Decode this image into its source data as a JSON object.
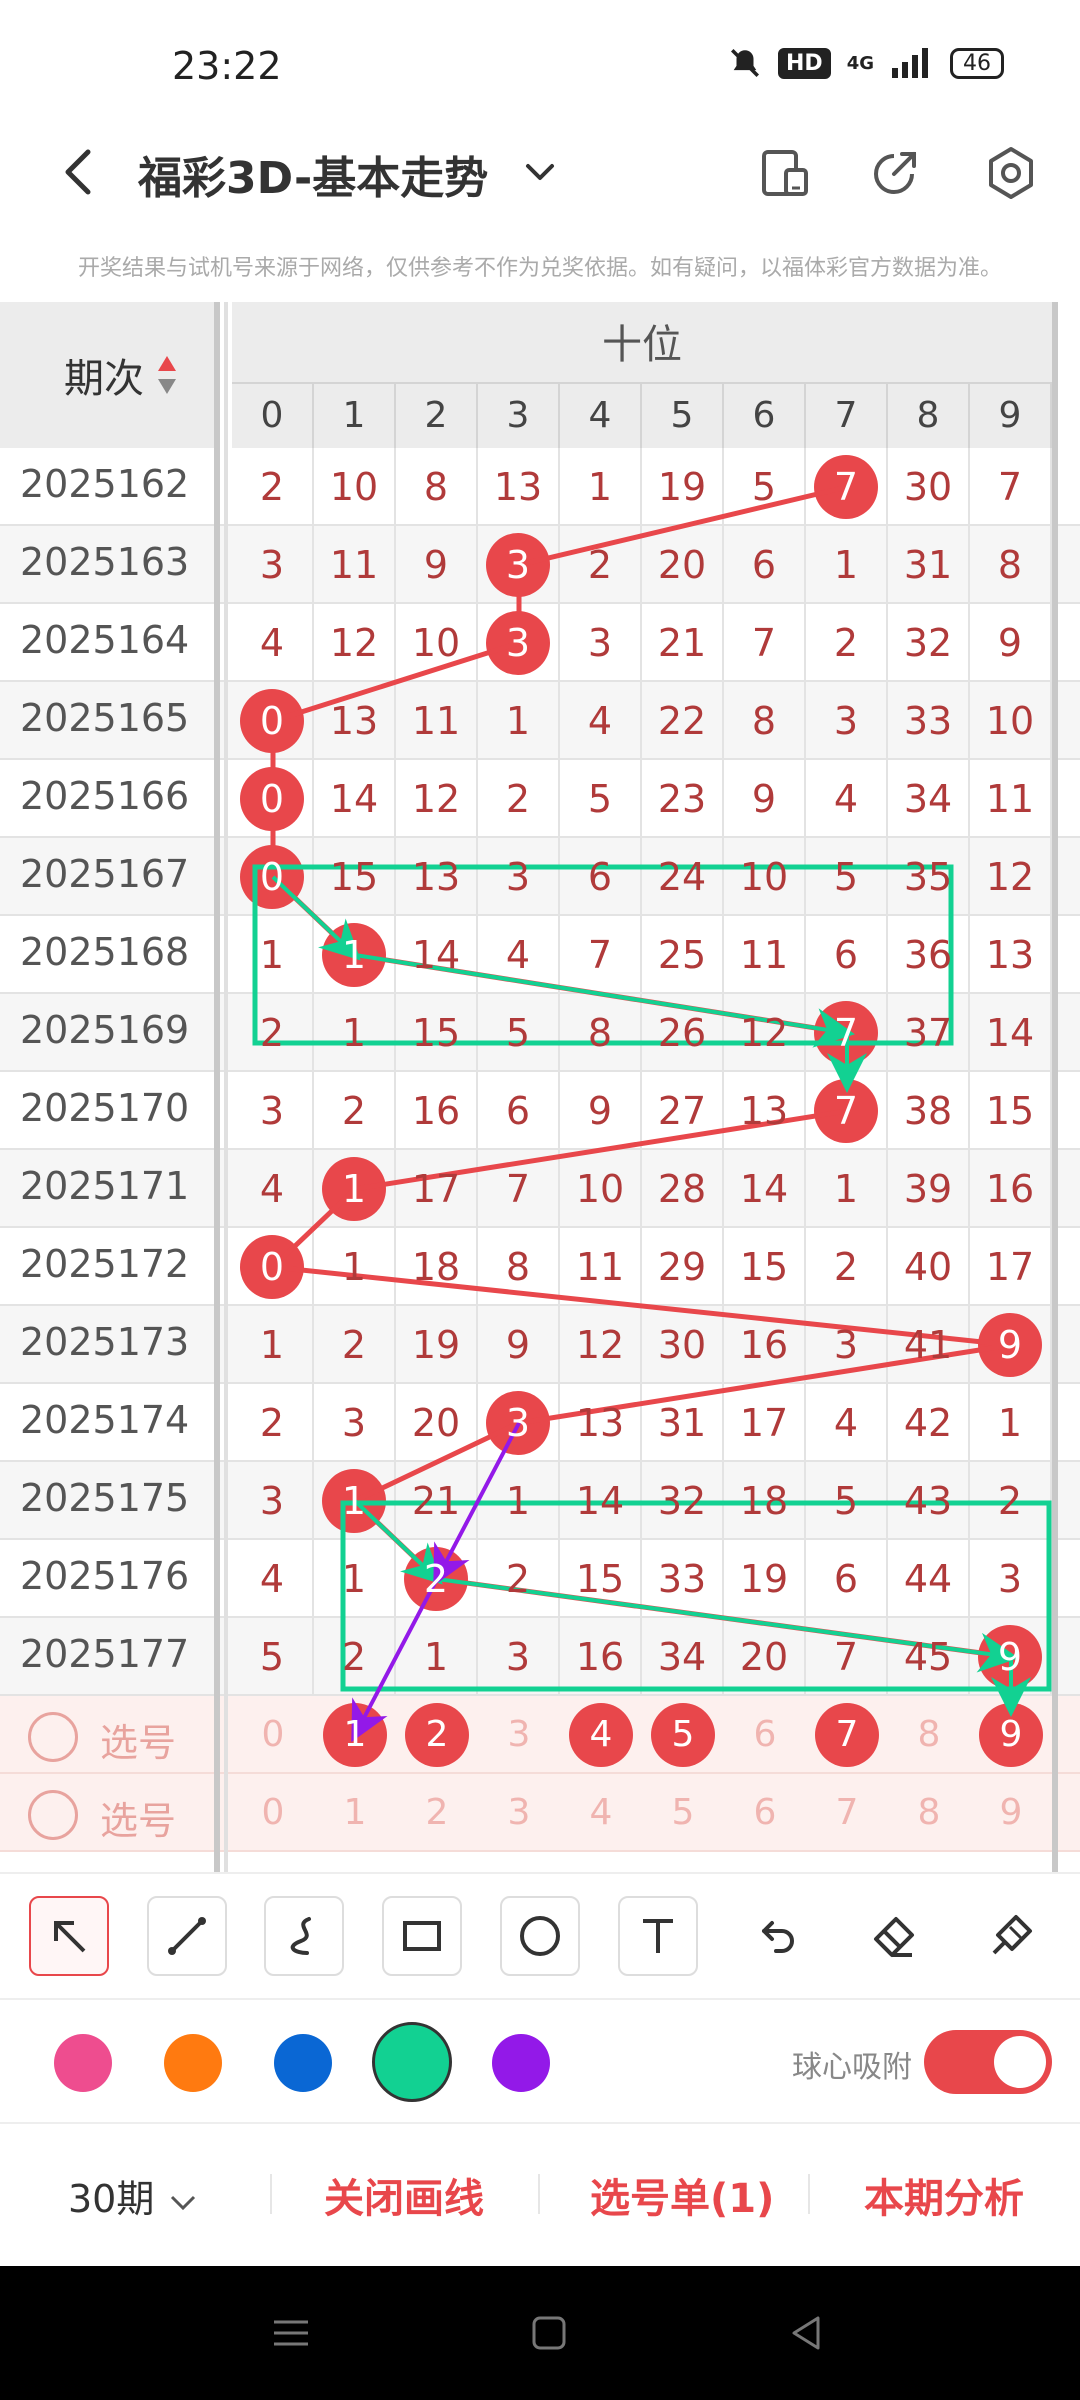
{
  "status": {
    "time": "23:22",
    "network": "4G",
    "battery": "46"
  },
  "header": {
    "title": "福彩3D-基本走势"
  },
  "notice": "开奖结果与试机号来源于网络，仅供参考不作为兑奖依据。如有疑问，以福体彩官方数据为准。",
  "table": {
    "period_header": "期次",
    "group_header": "十位",
    "digits": [
      "0",
      "1",
      "2",
      "3",
      "4",
      "5",
      "6",
      "7",
      "8",
      "9"
    ],
    "rows": [
      {
        "period": "2025162",
        "cells": [
          "2",
          "10",
          "8",
          "13",
          "1",
          "19",
          "5",
          "7",
          "30",
          "7"
        ],
        "hit": 7
      },
      {
        "period": "2025163",
        "cells": [
          "3",
          "11",
          "9",
          "3",
          "2",
          "20",
          "6",
          "1",
          "31",
          "8"
        ],
        "hit": 3
      },
      {
        "period": "2025164",
        "cells": [
          "4",
          "12",
          "10",
          "3",
          "3",
          "21",
          "7",
          "2",
          "32",
          "9"
        ],
        "hit": 3
      },
      {
        "period": "2025165",
        "cells": [
          "0",
          "13",
          "11",
          "1",
          "4",
          "22",
          "8",
          "3",
          "33",
          "10"
        ],
        "hit": 0
      },
      {
        "period": "2025166",
        "cells": [
          "0",
          "14",
          "12",
          "2",
          "5",
          "23",
          "9",
          "4",
          "34",
          "11"
        ],
        "hit": 0
      },
      {
        "period": "2025167",
        "cells": [
          "0",
          "15",
          "13",
          "3",
          "6",
          "24",
          "10",
          "5",
          "35",
          "12"
        ],
        "hit": 0
      },
      {
        "period": "2025168",
        "cells": [
          "1",
          "1",
          "14",
          "4",
          "7",
          "25",
          "11",
          "6",
          "36",
          "13"
        ],
        "hit": 1
      },
      {
        "period": "2025169",
        "cells": [
          "2",
          "1",
          "15",
          "5",
          "8",
          "26",
          "12",
          "7",
          "37",
          "14"
        ],
        "hit": 7
      },
      {
        "period": "2025170",
        "cells": [
          "3",
          "2",
          "16",
          "6",
          "9",
          "27",
          "13",
          "7",
          "38",
          "15"
        ],
        "hit": 7
      },
      {
        "period": "2025171",
        "cells": [
          "4",
          "1",
          "17",
          "7",
          "10",
          "28",
          "14",
          "1",
          "39",
          "16"
        ],
        "hit": 1
      },
      {
        "period": "2025172",
        "cells": [
          "0",
          "1",
          "18",
          "8",
          "11",
          "29",
          "15",
          "2",
          "40",
          "17"
        ],
        "hit": 0
      },
      {
        "period": "2025173",
        "cells": [
          "1",
          "2",
          "19",
          "9",
          "12",
          "30",
          "16",
          "3",
          "41",
          "9"
        ],
        "hit": 9
      },
      {
        "period": "2025174",
        "cells": [
          "2",
          "3",
          "20",
          "3",
          "13",
          "31",
          "17",
          "4",
          "42",
          "1"
        ],
        "hit": 3
      },
      {
        "period": "2025175",
        "cells": [
          "3",
          "1",
          "21",
          "1",
          "14",
          "32",
          "18",
          "5",
          "43",
          "2"
        ],
        "hit": 1
      },
      {
        "period": "2025176",
        "cells": [
          "4",
          "1",
          "2",
          "2",
          "15",
          "33",
          "19",
          "6",
          "44",
          "3"
        ],
        "hit": 2
      },
      {
        "period": "2025177",
        "cells": [
          "5",
          "2",
          "1",
          "3",
          "16",
          "34",
          "20",
          "7",
          "45",
          "9"
        ],
        "hit": 9
      }
    ],
    "pick_label": "选号",
    "pick_rows": [
      {
        "digits": [
          "0",
          "1",
          "2",
          "3",
          "4",
          "5",
          "6",
          "7",
          "8",
          "9"
        ],
        "selected": [
          1,
          2,
          4,
          5,
          7,
          9
        ]
      },
      {
        "digits": [
          "0",
          "1",
          "2",
          "3",
          "4",
          "5",
          "6",
          "7",
          "8",
          "9"
        ],
        "selected": []
      }
    ]
  },
  "draw": {
    "colors": [
      "#ee4d8f",
      "#ff7a10",
      "#0a67d4",
      "#12d192",
      "#9319e8"
    ],
    "selected_color": 3,
    "magnet_label": "球心吸附",
    "magnet_on": true
  },
  "bottom": {
    "period_select": "30期",
    "close_lines": "关闭画线",
    "pick_list": "选号单(1)",
    "analysis": "本期分析"
  }
}
